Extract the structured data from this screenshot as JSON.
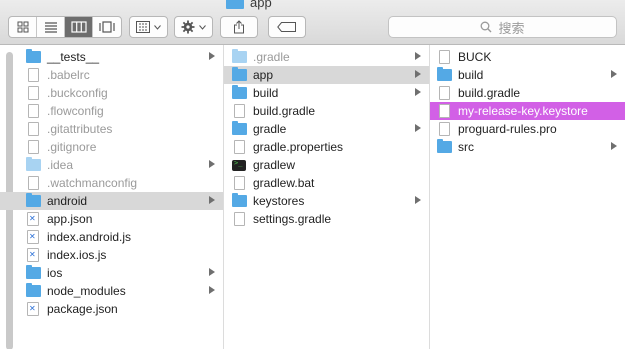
{
  "window": {
    "title": "app"
  },
  "search": {
    "placeholder": "搜索"
  },
  "toolbar": {
    "view_buttons": [
      "icon-view",
      "list-view",
      "column-view",
      "cover-flow-view"
    ]
  },
  "columns": [
    {
      "items": [
        {
          "label": "__tests__",
          "icon": "folder",
          "arrow": true
        },
        {
          "label": ".babelrc",
          "icon": "doc",
          "dim": true
        },
        {
          "label": ".buckconfig",
          "icon": "doc",
          "dim": true
        },
        {
          "label": ".flowconfig",
          "icon": "doc",
          "dim": true
        },
        {
          "label": ".gitattributes",
          "icon": "doc",
          "dim": true
        },
        {
          "label": ".gitignore",
          "icon": "doc",
          "dim": true
        },
        {
          "label": ".idea",
          "icon": "folder-light",
          "dim": true,
          "arrow": true
        },
        {
          "label": ".watchmanconfig",
          "icon": "doc",
          "dim": true
        },
        {
          "label": "android",
          "icon": "folder",
          "arrow": true,
          "selected": true
        },
        {
          "label": "app.json",
          "icon": "js"
        },
        {
          "label": "index.android.js",
          "icon": "js"
        },
        {
          "label": "index.ios.js",
          "icon": "js"
        },
        {
          "label": "ios",
          "icon": "folder",
          "arrow": true
        },
        {
          "label": "node_modules",
          "icon": "folder",
          "arrow": true
        },
        {
          "label": "package.json",
          "icon": "js"
        }
      ]
    },
    {
      "items": [
        {
          "label": ".gradle",
          "icon": "folder-light",
          "dim": true,
          "arrow": true
        },
        {
          "label": "app",
          "icon": "folder",
          "arrow": true,
          "selected": true
        },
        {
          "label": "build",
          "icon": "folder",
          "arrow": true
        },
        {
          "label": "build.gradle",
          "icon": "doc"
        },
        {
          "label": "gradle",
          "icon": "folder",
          "arrow": true
        },
        {
          "label": "gradle.properties",
          "icon": "doc"
        },
        {
          "label": "gradlew",
          "icon": "term"
        },
        {
          "label": "gradlew.bat",
          "icon": "doc"
        },
        {
          "label": "keystores",
          "icon": "folder",
          "arrow": true
        },
        {
          "label": "settings.gradle",
          "icon": "doc"
        }
      ]
    },
    {
      "items": [
        {
          "label": "BUCK",
          "icon": "doc"
        },
        {
          "label": "build",
          "icon": "folder",
          "arrow": true
        },
        {
          "label": "build.gradle",
          "icon": "doc"
        },
        {
          "label": "my-release-key.keystore",
          "icon": "doc",
          "highlighted": true
        },
        {
          "label": "proguard-rules.pro",
          "icon": "doc"
        },
        {
          "label": "src",
          "icon": "folder",
          "arrow": true
        }
      ]
    }
  ],
  "colors": {
    "highlight": "#d260e6",
    "folder": "#54a9e5",
    "selected_row": "#d8d8d8"
  }
}
